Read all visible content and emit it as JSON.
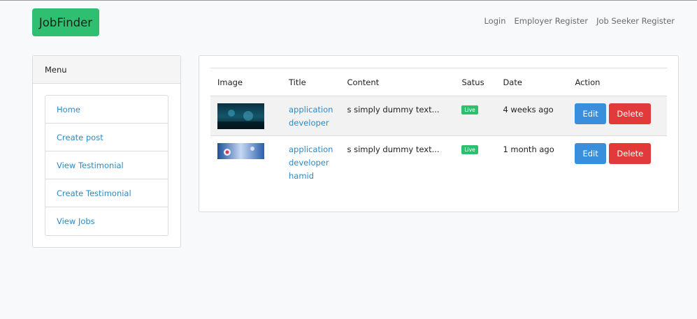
{
  "navbar": {
    "brand": "JobFinder",
    "links": [
      "Login",
      "Employer Register",
      "Job Seeker Register"
    ]
  },
  "menu": {
    "header": "Menu",
    "items": [
      "Home",
      "Create post",
      "View Testimonial",
      "Create Testimonial",
      "View Jobs"
    ]
  },
  "table": {
    "columns": [
      "Image",
      "Title",
      "Content",
      "Satus",
      "Date",
      "Action"
    ],
    "rows": [
      {
        "title_lines": [
          "application",
          "developer"
        ],
        "content": "s simply dummy text...",
        "status": "Live",
        "date": "4 weeks ago",
        "edit_label": "Edit",
        "delete_label": "Delete"
      },
      {
        "title_lines": [
          "application",
          "developer",
          "hamid"
        ],
        "content": "s simply dummy text...",
        "status": "Live",
        "date": "1 month ago",
        "edit_label": "Edit",
        "delete_label": "Delete"
      }
    ]
  },
  "colors": {
    "brand": "#2fbf71",
    "link": "#2d8ac7",
    "edit": "#3a8fdc",
    "delete": "#e23a3a"
  }
}
